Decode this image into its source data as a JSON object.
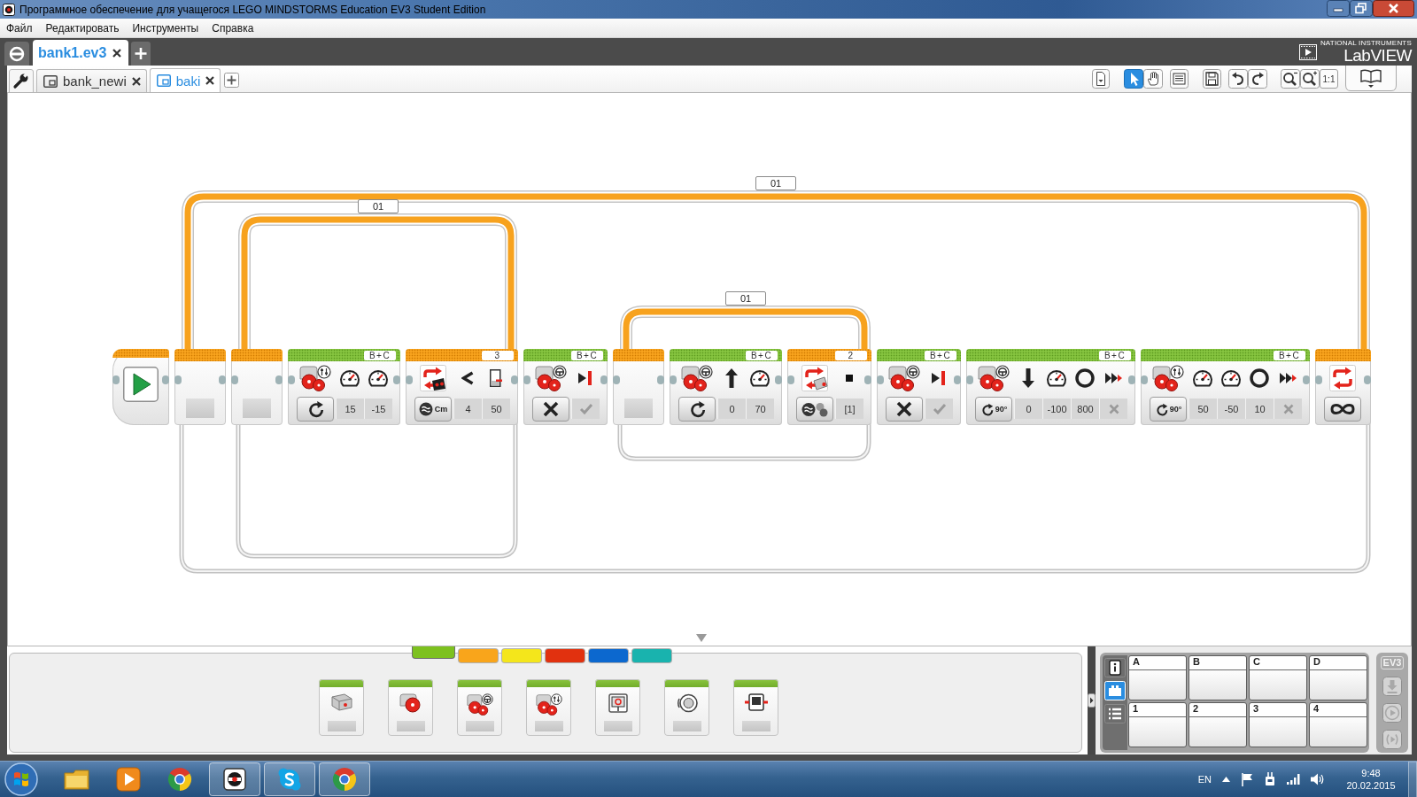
{
  "window": {
    "title": "Программное обеспечение для учащегося LEGO MINDSTORMS Education EV3 Student Edition"
  },
  "menu": [
    {
      "label": "Файл"
    },
    {
      "label": "Редактировать"
    },
    {
      "label": "Инструменты"
    },
    {
      "label": "Справка"
    }
  ],
  "project_tabs": [
    {
      "label": "bank1.ev3",
      "selected": true
    }
  ],
  "brand": {
    "maker": "NATIONAL INSTRUMENTS",
    "product": "LabVIEW"
  },
  "program_tabs": [
    {
      "label": "bank_newi",
      "selected": false
    },
    {
      "label": "baki",
      "selected": true
    }
  ],
  "toolbar": {
    "tools": [
      {
        "kind": "pointer",
        "selected": true
      },
      {
        "kind": "pan",
        "selected": false
      }
    ],
    "zoom_reset": "1:1"
  },
  "program": {
    "blocks": [
      {
        "kind": "start"
      },
      {
        "kind": "loop",
        "label": "01",
        "children": [
          {
            "kind": "loop",
            "label": "01",
            "children": [
              {
                "kind": "move_tank",
                "port": "B+C",
                "mode": {
                  "kind": "on"
                },
                "params": [
                  {
                    "kind": "power",
                    "value": "15"
                  },
                  {
                    "kind": "power",
                    "value": "-15"
                  }
                ]
              }
            ],
            "port": "3",
            "mode": {
              "kind": "ultrasonic",
              "label": "Cm"
            },
            "params": [
              {
                "kind": "compare_type",
                "value": "4"
              },
              {
                "kind": "threshold",
                "value": "50"
              }
            ]
          },
          {
            "kind": "move_steering",
            "port": "B+C",
            "mode": {
              "kind": "off"
            },
            "params": [
              {
                "kind": "brake",
                "value": true
              }
            ]
          },
          {
            "kind": "loop",
            "label": "01",
            "children": [
              {
                "kind": "move_steering",
                "port": "B+C",
                "mode": {
                  "kind": "on"
                },
                "params": [
                  {
                    "kind": "steering",
                    "reverse": false,
                    "value": "0"
                  },
                  {
                    "kind": "power",
                    "value": "70"
                  }
                ]
              }
            ],
            "port": "2",
            "mode": {
              "kind": "touch"
            },
            "params": [
              {
                "kind": "state",
                "value": "[1]"
              }
            ]
          },
          {
            "kind": "move_steering",
            "port": "B+C",
            "mode": {
              "kind": "off"
            },
            "params": [
              {
                "kind": "brake",
                "value": true
              }
            ]
          },
          {
            "kind": "move_steering",
            "port": "B+C",
            "mode": {
              "kind": "degrees",
              "label": "90°"
            },
            "params": [
              {
                "kind": "steering",
                "reverse": true,
                "value": "0"
              },
              {
                "kind": "power",
                "value": "-100"
              },
              {
                "kind": "degrees",
                "value": "800"
              },
              {
                "kind": "brake",
                "value": false
              }
            ]
          },
          {
            "kind": "move_tank",
            "port": "B+C",
            "mode": {
              "kind": "degrees",
              "label": "90°"
            },
            "params": [
              {
                "kind": "power",
                "value": "50"
              },
              {
                "kind": "power",
                "value": "-50"
              },
              {
                "kind": "degrees",
                "value": "10"
              },
              {
                "kind": "brake",
                "value": false
              }
            ]
          }
        ],
        "mode": {
          "kind": "unlimited"
        }
      }
    ]
  },
  "palette": {
    "categories": [
      {
        "color": "#7dc11f",
        "selected": true
      },
      {
        "color": "#f9a51b",
        "selected": false
      },
      {
        "color": "#f4e61b",
        "selected": false
      },
      {
        "color": "#e1310f",
        "selected": false
      },
      {
        "color": "#0c68cf",
        "selected": false
      },
      {
        "color": "#19b3ae",
        "selected": false
      }
    ],
    "blocks": [
      {
        "kind": "medium_motor"
      },
      {
        "kind": "large_motor"
      },
      {
        "kind": "move_steering"
      },
      {
        "kind": "move_tank"
      },
      {
        "kind": "display"
      },
      {
        "kind": "sound"
      },
      {
        "kind": "brick_status_light"
      }
    ]
  },
  "hardware": {
    "tabs": [
      {
        "kind": "brick_info",
        "selected": false
      },
      {
        "kind": "port_view",
        "selected": true
      },
      {
        "kind": "available_bricks",
        "selected": false
      }
    ],
    "ports": [
      {
        "label": "A"
      },
      {
        "label": "B"
      },
      {
        "label": "C"
      },
      {
        "label": "D"
      },
      {
        "label": "1"
      },
      {
        "label": "2"
      },
      {
        "label": "3"
      },
      {
        "label": "4"
      }
    ],
    "brick": "EV3",
    "controls": [
      {
        "kind": "download",
        "disabled": true
      },
      {
        "kind": "run",
        "disabled": true
      },
      {
        "kind": "run_selected",
        "disabled": true
      }
    ]
  },
  "taskbar": {
    "apps": [
      {
        "kind": "folder",
        "running": false
      },
      {
        "kind": "media",
        "running": false
      },
      {
        "kind": "browser",
        "running": false
      },
      {
        "kind": "ev3",
        "running": true
      },
      {
        "kind": "messenger",
        "running": true
      },
      {
        "kind": "browser",
        "running": true
      }
    ],
    "language": "EN",
    "time": "9:48",
    "date": "20.02.2015"
  }
}
